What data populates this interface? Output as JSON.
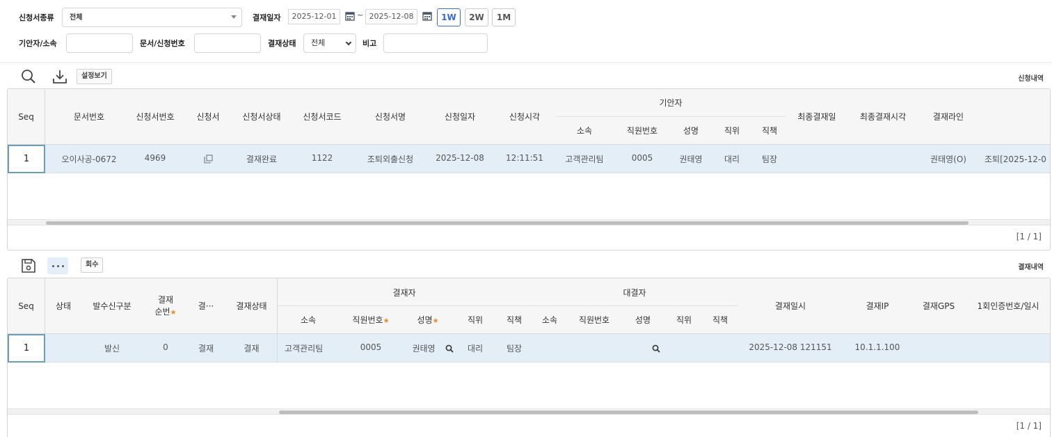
{
  "filter": {
    "doc_type_label": "신청서종류",
    "doc_type_value": "전체",
    "approval_date_label": "결재일자",
    "date_from": "2025-12-01",
    "tilde": "~",
    "date_to": "2025-12-08",
    "period_buttons": [
      "1W",
      "2W",
      "1M"
    ],
    "drafter_label": "기안자/소속",
    "drafter_value": "",
    "doc_no_label": "문서/신청번호",
    "doc_no_value": "",
    "status_label": "결재상태",
    "status_value": "전체",
    "remark_label": "비고",
    "remark_value": ""
  },
  "top_toolbar": {
    "view_settings_label": "설정보기",
    "section_title": "신청내역"
  },
  "top_grid": {
    "headers": {
      "seq": "Seq",
      "doc_no": "문서번호",
      "app_no": "신청서번호",
      "app_form": "신청서",
      "app_status": "신청서상태",
      "app_code": "신청서코드",
      "app_name": "신청서명",
      "app_date": "신청일자",
      "app_time": "신청시각",
      "drafter_group": "기안자",
      "dept": "소속",
      "emp_no": "직원번호",
      "name": "성명",
      "position": "직위",
      "duty": "직책",
      "final_date": "최종결재일",
      "final_time": "최종결재시각",
      "approval_line": "결재라인"
    },
    "row": {
      "seq": "1",
      "doc_no": "오이사공-0672",
      "app_no": "4969",
      "app_status": "결재완료",
      "app_code": "1122",
      "app_name": "조퇴외출신청",
      "app_date": "2025-12-08",
      "app_time": "12:11:51",
      "dept": "고객관리팀",
      "emp_no": "0005",
      "name": "권태영",
      "position": "대리",
      "duty": "팀장",
      "final_date": "",
      "final_time": "",
      "approval_line": "권태영(O)",
      "extra": "조퇴[2025-12-0"
    },
    "pager": "[1 / 1]"
  },
  "bottom_toolbar": {
    "recall_label": "회수",
    "section_title": "결재내역"
  },
  "bottom_grid": {
    "headers": {
      "seq": "Seq",
      "state": "상태",
      "send_recv": "발수신구분",
      "order_line1": "결재",
      "order_line2": "순번",
      "approval_truncated": "결···",
      "approval_status": "결재상태",
      "approver_group": "결재자",
      "proxy_group": "대결자",
      "dept": "소속",
      "emp_no": "직원번호",
      "name": "성명",
      "position": "직위",
      "duty": "직책",
      "proxy_dept": "소속",
      "proxy_emp_no": "직원번호",
      "proxy_name": "성명",
      "proxy_position": "직위",
      "proxy_duty": "직책",
      "approval_datetime": "결재일시",
      "approval_ip": "결재IP",
      "approval_gps": "결재GPS",
      "otp": "1회인증번호/일시",
      "required_mark": "★"
    },
    "row": {
      "seq": "1",
      "state": "",
      "send_recv": "발신",
      "order": "0",
      "approval_type": "결재",
      "approval_status": "결재",
      "dept": "고객관리팀",
      "emp_no": "0005",
      "name": "권태영",
      "position": "대리",
      "duty": "팀장",
      "approval_datetime": "2025-12-08 121151",
      "approval_ip": "10.1.1.100"
    },
    "pager": "[1 / 1]"
  },
  "colors": {
    "accent": "#2f6bd0",
    "selected_row": "#e3eef7",
    "header_bg": "#f6f6f6",
    "required_star": "#f08a24"
  }
}
